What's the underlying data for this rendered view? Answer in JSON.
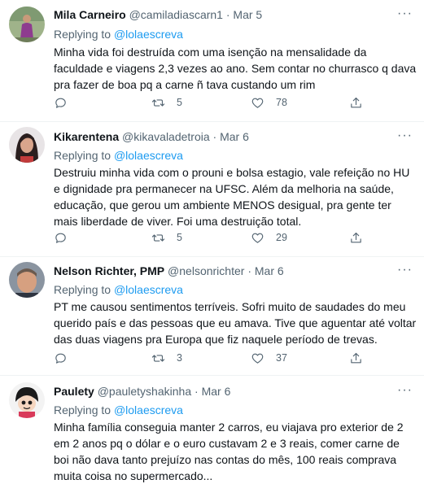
{
  "tweets": [
    {
      "name": "Mila Carneiro",
      "handle": "@camiladiascarn1",
      "dot": "·",
      "date": "Mar 5",
      "replying_prefix": "Replying to",
      "replying_to": "@lolaescreva",
      "text": "Minha vida foi destruída com uma isenção na mensalidade da faculdade e viagens 2,3 vezes ao ano. Sem contar no churrasco q dava pra fazer de boa pq a carne ñ tava custando um rim",
      "reply_count": "",
      "retweet_count": "5",
      "like_count": "78",
      "avatar_icon": "avatar-photo-woman-purple-dress"
    },
    {
      "name": "Kikarentena",
      "handle": "@kikavaladetroia",
      "dot": "·",
      "date": "Mar 6",
      "replying_prefix": "Replying to",
      "replying_to": "@lolaescreva",
      "text": "Destruiu minha vida com o prouni e bolsa estagio, vale refeição no HU e dignidade pra permanecer na UFSC. Além da melhoria na saúde, educação, que gerou um ambiente MENOS desigual, pra gente ter mais liberdade de viver. Foi uma destruição total.",
      "reply_count": "",
      "retweet_count": "5",
      "like_count": "29",
      "avatar_icon": "avatar-photo-woman-dark-hair"
    },
    {
      "name": "Nelson Richter, PMP",
      "handle": "@nelsonrichter",
      "dot": "·",
      "date": "Mar 6",
      "replying_prefix": "Replying to",
      "replying_to": "@lolaescreva",
      "text": "PT me causou sentimentos terríveis. Sofri muito de saudades do meu querido país e das pessoas que eu amava. Tive que aguentar até voltar das duas viagens pra Europa que fiz naquele período de trevas.",
      "reply_count": "",
      "retweet_count": "3",
      "like_count": "37",
      "avatar_icon": "avatar-photo-man"
    },
    {
      "name": "Paulety",
      "handle": "@pauletyshakinha",
      "dot": "·",
      "date": "Mar 6",
      "replying_prefix": "Replying to",
      "replying_to": "@lolaescreva",
      "text": "Minha família conseguia manter 2 carros, eu viajava pro exterior de 2 em 2 anos pq o dólar e o euro custavam 2 e 3 reais, comer carne de boi não dava tanto prejuízo nas contas do mês, 100 reais comprava muita coisa no supermercado...",
      "reply_count": "",
      "retweet_count": "",
      "like_count": "",
      "avatar_icon": "avatar-cartoon-character"
    }
  ],
  "icons": {
    "more": "more-horizontal-icon",
    "reply": "reply-bubble-icon",
    "retweet": "retweet-icon",
    "like": "heart-icon",
    "share": "share-icon"
  },
  "colors": {
    "link": "#1d9bf0",
    "secondary_text": "#536471",
    "divider": "#eff3f4"
  }
}
